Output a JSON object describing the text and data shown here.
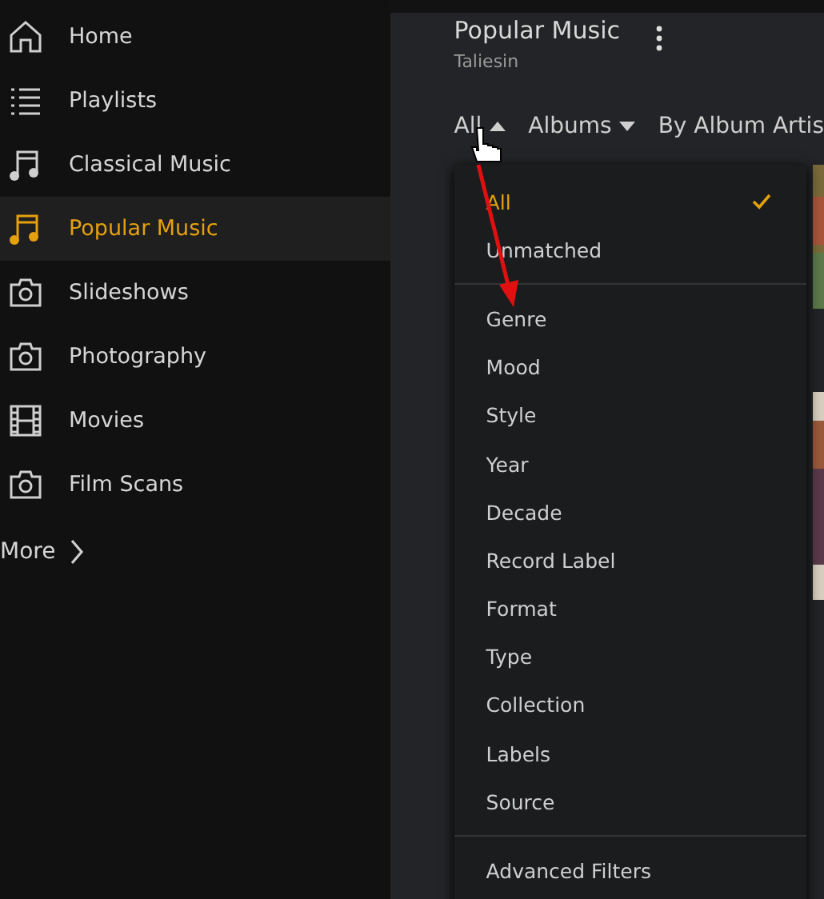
{
  "sidebar": {
    "items": [
      {
        "label": "Home",
        "kind": "home",
        "selected": false
      },
      {
        "label": "Playlists",
        "kind": "playlist",
        "selected": false
      },
      {
        "label": "Classical Music",
        "kind": "music",
        "selected": false
      },
      {
        "label": "Popular Music",
        "kind": "music",
        "selected": true
      },
      {
        "label": "Slideshows",
        "selected": false
      },
      {
        "label": "Photography",
        "selected": false
      },
      {
        "label": "Movies",
        "kind": "video",
        "selected": false
      },
      {
        "label": "Film Scans",
        "selected": false
      }
    ],
    "more": "More"
  },
  "header": {
    "title": "Popular Music",
    "subtitle": "Taliesin"
  },
  "filters": [
    {
      "label": "All",
      "expanded": true
    },
    {
      "label": "Albums",
      "expanded": false
    },
    {
      "label": "By Album Artis"
    }
  ],
  "menu": {
    "groups": [
      [
        {
          "label": "All",
          "selected": true
        },
        {
          "label": "Unmatched",
          "selected": false
        }
      ],
      [
        {
          "label": "Genre",
          "selected": false
        },
        {
          "label": "Mood",
          "selected": false
        },
        {
          "label": "Style",
          "selected": false
        },
        {
          "label": "Year",
          "selected": false
        },
        {
          "label": "Decade",
          "selected": false
        },
        {
          "label": "Record Label",
          "selected": false
        },
        {
          "label": "Format",
          "selected": false
        },
        {
          "label": "Type",
          "selected": false
        },
        {
          "label": "Collection",
          "selected": false
        },
        {
          "label": "Labels",
          "selected": false
        },
        {
          "label": "Source",
          "selected": false
        }
      ],
      [
        {
          "label": "Advanced Filters",
          "selected": false
        }
      ]
    ]
  }
}
